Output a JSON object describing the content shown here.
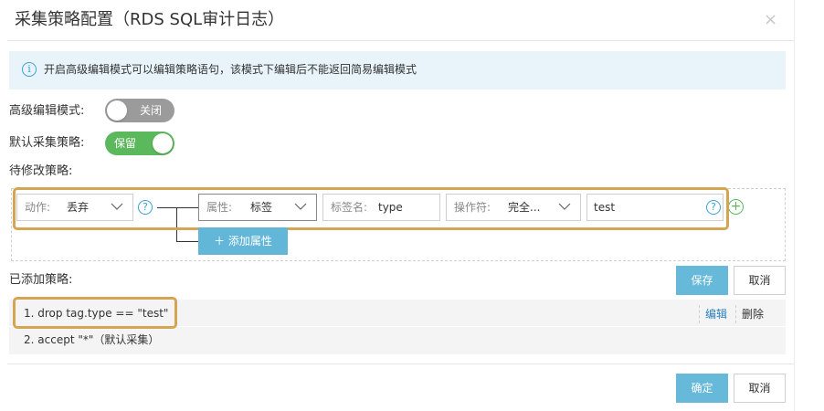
{
  "dialog": {
    "title": "采集策略配置（RDS SQL审计日志）",
    "close_glyph": "×"
  },
  "notice": {
    "text": "开启高级编辑模式可以编辑策略语句，该模式下编辑后不能返回简易编辑模式"
  },
  "advanced_mode": {
    "label": "高级编辑模式:",
    "state": "off",
    "switch_text": "关闭"
  },
  "default_policy": {
    "label": "默认采集策略:",
    "state": "on",
    "switch_text": "保留"
  },
  "pending": {
    "label": "待修改策略:",
    "action": {
      "label": "动作:",
      "value": "丢弃"
    },
    "attribute": {
      "label": "属性:",
      "value": "标签"
    },
    "tag_name": {
      "label": "标签名:",
      "value": "type"
    },
    "operator": {
      "label": "操作符:",
      "value": "完全..."
    },
    "match_value": "test",
    "add_attribute_button": "＋ 添加属性"
  },
  "added": {
    "label": "已添加策略:",
    "save_button": "保存",
    "cancel_button": "取消",
    "items": [
      {
        "text": "1.  drop tag.type == \"test\"",
        "edit": "编辑",
        "delete": "删除"
      },
      {
        "text": "2.  accept \"*\"（默认采集）"
      }
    ]
  },
  "footer": {
    "confirm_button": "确定",
    "cancel_button": "取消"
  },
  "colors": {
    "accent_blue": "#39a2d5",
    "primary_button": "#66b9d9",
    "switch_on": "#5cb85c",
    "switch_off": "#9b9b9b",
    "highlight_border": "#d4a654",
    "notice_bg": "#e8f4fa",
    "link": "#2a7fc0"
  },
  "icons": {
    "close": "close-icon",
    "info": "info-icon",
    "help": "help-icon",
    "chevron": "chevron-down-icon",
    "add": "plus-circle-icon"
  }
}
